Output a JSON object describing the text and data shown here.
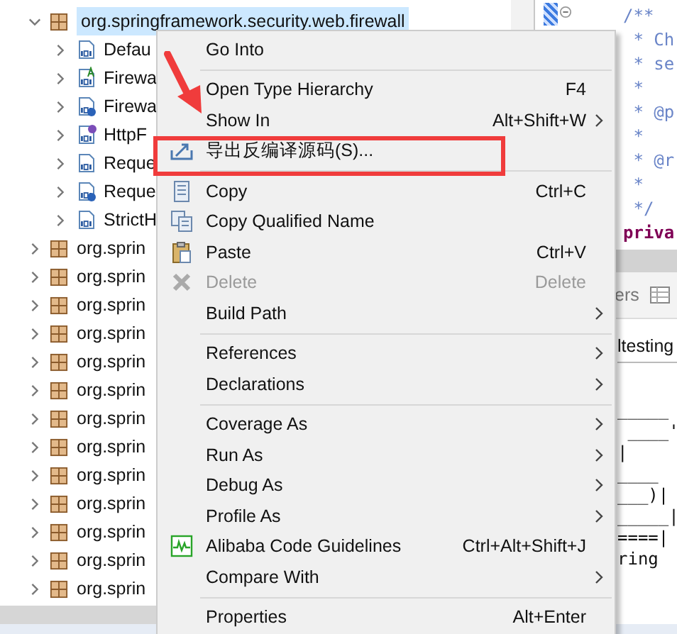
{
  "tree": {
    "items": [
      {
        "label": "org.springframework.security.web.firewall",
        "kind": "package",
        "expanded": true,
        "selected": true,
        "children": [
          {
            "label": "Defau",
            "kind": "class"
          },
          {
            "label": "Firewa",
            "kind": "abstract"
          },
          {
            "label": "Firewa",
            "kind": "guarded"
          },
          {
            "label": "HttpF",
            "kind": "interface"
          },
          {
            "label": "Reque",
            "kind": "class"
          },
          {
            "label": "Reque",
            "kind": "guarded"
          },
          {
            "label": "StrictH",
            "kind": "class"
          }
        ]
      },
      {
        "label": "org.sprin",
        "kind": "package",
        "expanded": false,
        "selected": false
      },
      {
        "label": "org.sprin",
        "kind": "package",
        "expanded": false,
        "selected": false
      },
      {
        "label": "org.sprin",
        "kind": "package",
        "expanded": false,
        "selected": false
      },
      {
        "label": "org.sprin",
        "kind": "package",
        "expanded": false,
        "selected": false
      },
      {
        "label": "org.sprin",
        "kind": "package",
        "expanded": false,
        "selected": false
      },
      {
        "label": "org.sprin",
        "kind": "package",
        "expanded": false,
        "selected": false
      },
      {
        "label": "org.sprin",
        "kind": "package",
        "expanded": false,
        "selected": false
      },
      {
        "label": "org.sprin",
        "kind": "package",
        "expanded": false,
        "selected": false
      },
      {
        "label": "org.sprin",
        "kind": "package",
        "expanded": false,
        "selected": false
      },
      {
        "label": "org.sprin",
        "kind": "package",
        "expanded": false,
        "selected": false
      },
      {
        "label": "org.sprin",
        "kind": "package",
        "expanded": false,
        "selected": false
      },
      {
        "label": "org.sprin",
        "kind": "package",
        "expanded": false,
        "selected": false
      },
      {
        "label": "org.sprin",
        "kind": "package",
        "expanded": false,
        "selected": false
      }
    ]
  },
  "context_menu": {
    "items": [
      {
        "kind": "item",
        "label": "Go Into",
        "submenu": false,
        "disabled": false,
        "annotated": false
      },
      {
        "kind": "separator"
      },
      {
        "kind": "item",
        "label": "Open Type Hierarchy",
        "shortcut": "F4",
        "submenu": false,
        "disabled": false,
        "annotated": false
      },
      {
        "kind": "item",
        "label": "Show In",
        "shortcut": "Alt+Shift+W",
        "submenu": true,
        "disabled": false,
        "annotated": false
      },
      {
        "kind": "export",
        "label": "导出反编译源码(S)...",
        "submenu": false,
        "disabled": false,
        "annotated": true
      },
      {
        "kind": "separator"
      },
      {
        "kind": "copy",
        "label": "Copy",
        "shortcut": "Ctrl+C",
        "submenu": false,
        "disabled": false,
        "annotated": false
      },
      {
        "kind": "copyname",
        "label": "Copy Qualified Name",
        "submenu": false,
        "disabled": false,
        "annotated": false
      },
      {
        "kind": "paste",
        "label": "Paste",
        "shortcut": "Ctrl+V",
        "submenu": false,
        "disabled": false,
        "annotated": false
      },
      {
        "kind": "delete",
        "label": "Delete",
        "shortcut": "Delete",
        "submenu": false,
        "disabled": true,
        "annotated": false
      },
      {
        "kind": "item",
        "label": "Build Path",
        "submenu": true,
        "disabled": false,
        "annotated": false
      },
      {
        "kind": "separator"
      },
      {
        "kind": "item",
        "label": "References",
        "submenu": true,
        "disabled": false,
        "annotated": false
      },
      {
        "kind": "item",
        "label": "Declarations",
        "submenu": true,
        "disabled": false,
        "annotated": false
      },
      {
        "kind": "separator"
      },
      {
        "kind": "item",
        "label": "Coverage As",
        "submenu": true,
        "disabled": false,
        "annotated": false
      },
      {
        "kind": "item",
        "label": "Run As",
        "submenu": true,
        "disabled": false,
        "annotated": false
      },
      {
        "kind": "item",
        "label": "Debug As",
        "submenu": true,
        "disabled": false,
        "annotated": false
      },
      {
        "kind": "item",
        "label": "Profile As",
        "submenu": true,
        "disabled": false,
        "annotated": false
      },
      {
        "kind": "monitor",
        "label": "Alibaba Code Guidelines",
        "shortcut": "Ctrl+Alt+Shift+J",
        "submenu": false,
        "disabled": false,
        "annotated": false
      },
      {
        "kind": "item",
        "label": "Compare With",
        "submenu": true,
        "disabled": false,
        "annotated": false
      },
      {
        "kind": "separator"
      },
      {
        "kind": "item",
        "label": "Properties",
        "shortcut": "Alt+Enter",
        "submenu": false,
        "disabled": false,
        "annotated": false
      }
    ]
  },
  "editor": {
    "lines": [
      {
        "kind": "comment",
        "text": "/**"
      },
      {
        "kind": "comment",
        "text": " * Ch"
      },
      {
        "kind": "comment",
        "text": " * se"
      },
      {
        "kind": "comment",
        "text": " *"
      },
      {
        "kind": "comment",
        "text": " * @p"
      },
      {
        "kind": "comment",
        "text": " *"
      },
      {
        "kind": "comment",
        "text": " * @r"
      },
      {
        "kind": "comment",
        "text": " *"
      },
      {
        "kind": "comment",
        "text": " */"
      },
      {
        "kind": "keyword",
        "text": "priva"
      }
    ]
  },
  "bottom_panel": {
    "tab": "ers",
    "header": "ltesting",
    "lines": [
      "_____",
      " ____'",
      "|",
      "____",
      "___)|",
      "_____|",
      "====|",
      "ring"
    ]
  }
}
